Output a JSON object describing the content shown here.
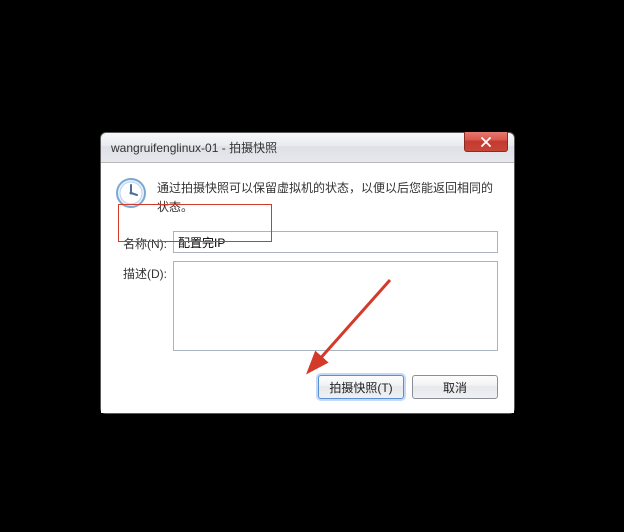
{
  "dialog": {
    "title": "wangruifenglinux-01 - 拍摄快照",
    "info": "通过拍摄快照可以保留虚拟机的状态，以便以后您能返回相同的状态。",
    "name_label": "名称(N):",
    "name_value": "配置完IP",
    "desc_label": "描述(D):",
    "desc_value": "",
    "ok_label": "拍摄快照(T)",
    "cancel_label": "取消"
  }
}
